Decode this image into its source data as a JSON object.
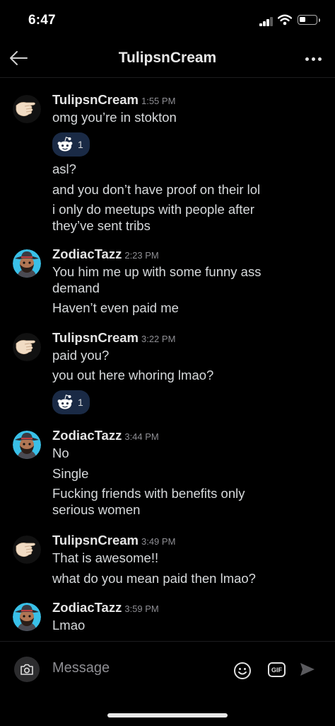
{
  "status_bar": {
    "time": "6:47"
  },
  "header": {
    "title": "TulipsnCream",
    "back_icon": "arrow-left-icon",
    "menu_icon": "more-horizontal-icon"
  },
  "users": {
    "tulip": {
      "name": "TulipsnCream",
      "avatar": "hand-avatar-icon"
    },
    "zodiac": {
      "name": "ZodiacTazz",
      "avatar": "bearded-hat-avatar-icon"
    }
  },
  "groups": [
    {
      "user": "TulipsnCream",
      "time": "1:55 PM",
      "messages": [
        "omg you’re in stokton",
        "asl?",
        "and you don’t have proof on their lol",
        "i only do meetups with people after",
        "they’ve sent tribs"
      ],
      "reaction": {
        "icon": "snoo-face-icon",
        "count": "1"
      }
    },
    {
      "user": "ZodiacTazz",
      "time": "2:23 PM",
      "messages": [
        "You him me up with some funny ass",
        "demand",
        "Haven’t even paid me"
      ]
    },
    {
      "user": "TulipsnCream",
      "time": "3:22 PM",
      "messages": [
        "paid you?",
        "you out here whoring lmao?"
      ],
      "reaction": {
        "icon": "snoo-face-icon",
        "count": "1"
      }
    },
    {
      "user": "ZodiacTazz",
      "time": "3:44 PM",
      "messages": [
        "No",
        "Single",
        "Fucking friends with benefits only",
        "serious women"
      ]
    },
    {
      "user": "TulipsnCream",
      "time": "3:49 PM",
      "messages": [
        "That is awesome!!",
        "what do you mean paid then lmao?"
      ]
    },
    {
      "user": "ZodiacTazz",
      "time": "3:59 PM",
      "messages": [
        "Lmao"
      ]
    }
  ],
  "composer": {
    "placeholder": "Message",
    "gif_label": "GIF",
    "camera_icon": "camera-icon",
    "emoji_icon": "smiley-icon",
    "send_icon": "send-icon"
  }
}
